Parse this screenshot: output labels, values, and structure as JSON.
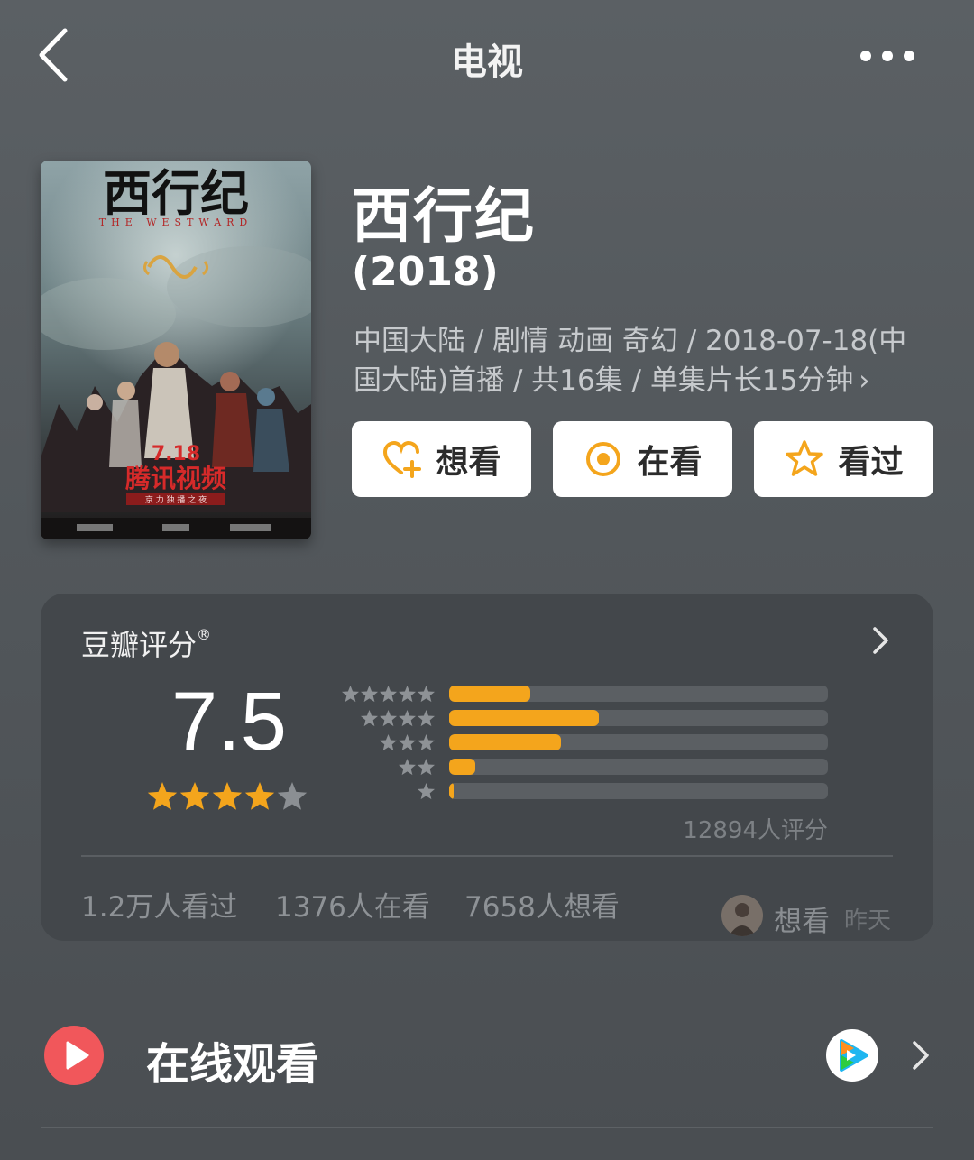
{
  "header": {
    "title": "电视",
    "back_icon": "chevron-left-icon",
    "more_icon": "more-dots-icon"
  },
  "poster": {
    "calligraphy_title": "西行纪",
    "english_title": "THE WESTWARD",
    "release_date": "7.18",
    "platform_text": "腾讯视频",
    "tagline": "京 力 独 播 之 夜"
  },
  "work": {
    "title": "西行纪",
    "year": "(2018)",
    "meta": "中国大陆 / 剧情 动画 奇幻 / 2018-07-18(中国大陆)首播 / 共16集 / 单集片长15分钟",
    "meta_chevron": "›"
  },
  "actions": [
    {
      "label": "想看",
      "icon": "heart-plus-icon"
    },
    {
      "label": "在看",
      "icon": "target-circle-icon"
    },
    {
      "label": "看过",
      "icon": "star-outline-icon"
    }
  ],
  "rating": {
    "source_label": "豆瓣评分",
    "registered_mark": "®",
    "score": "7.5",
    "stars_filled": 4,
    "stars_total": 5,
    "distribution": [
      {
        "stars": 5,
        "percent": 21.5
      },
      {
        "stars": 4,
        "percent": 39.5
      },
      {
        "stars": 3,
        "percent": 29.5
      },
      {
        "stars": 2,
        "percent": 7.0
      },
      {
        "stars": 1,
        "percent": 1.2
      }
    ],
    "count_text": "12894人评分",
    "stats": {
      "watched": "1.2万人看过",
      "watching": "1376人在看",
      "want": "7658人想看"
    },
    "recent": {
      "action": "想看",
      "time": "昨天"
    }
  },
  "online_watch": {
    "title": "在线观看",
    "play_icon": "play-circle-icon",
    "provider_icon": "tencent-video-icon"
  },
  "colors": {
    "accent_orange": "#f4a51c",
    "play_red": "#f1575b",
    "card_bg": "#43474b"
  }
}
